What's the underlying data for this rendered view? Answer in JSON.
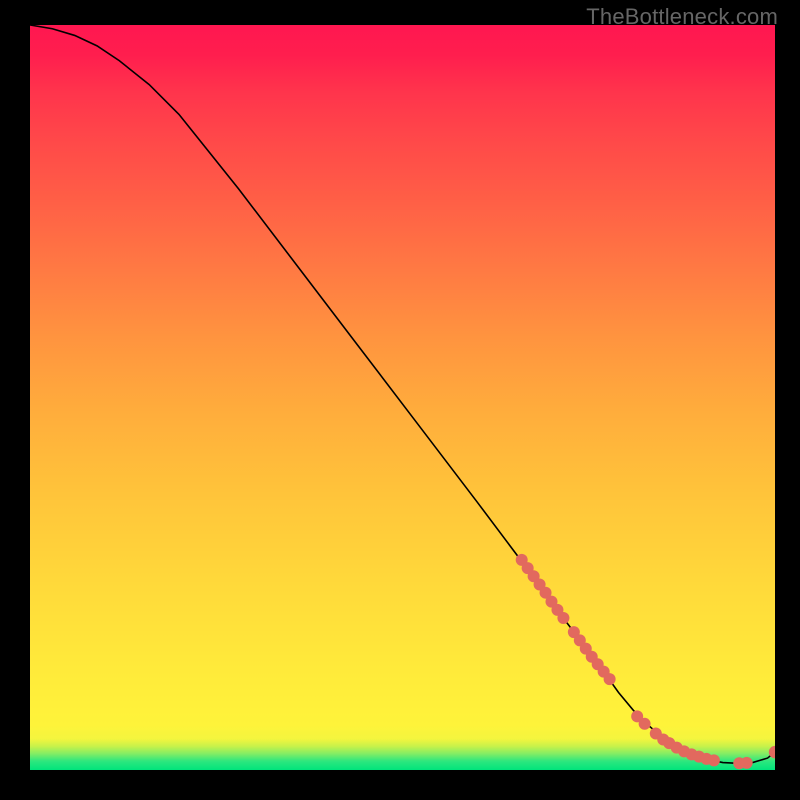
{
  "watermark": "TheBottleneck.com",
  "chart_data": {
    "type": "line",
    "title": "",
    "xlabel": "",
    "ylabel": "",
    "xlim": [
      0,
      100
    ],
    "ylim": [
      0,
      100
    ],
    "grid": false,
    "axes_visible": false,
    "series": [
      {
        "name": "bottleneck-curve",
        "x": [
          0,
          3,
          6,
          9,
          12,
          16,
          20,
          28,
          36,
          44,
          52,
          60,
          66,
          70,
          74,
          77,
          79,
          81,
          83,
          85,
          87,
          89,
          91,
          93,
          95,
          97,
          99,
          100
        ],
        "y": [
          100,
          99.5,
          98.6,
          97.2,
          95.2,
          92,
          88,
          78,
          67.5,
          57,
          46.5,
          36,
          28,
          22.5,
          17.2,
          13.2,
          10.4,
          8.0,
          6.0,
          4.3,
          3.0,
          2.0,
          1.4,
          1.0,
          0.9,
          1.0,
          1.6,
          2.4
        ]
      }
    ],
    "dot_groups": [
      {
        "name": "upper-cluster",
        "points": [
          [
            66.0,
            28.2
          ],
          [
            66.8,
            27.1
          ],
          [
            67.6,
            26.0
          ],
          [
            68.4,
            24.9
          ],
          [
            69.2,
            23.8
          ],
          [
            70.0,
            22.6
          ],
          [
            70.8,
            21.5
          ],
          [
            71.6,
            20.4
          ],
          [
            73.0,
            18.5
          ],
          [
            73.8,
            17.4
          ],
          [
            74.6,
            16.3
          ],
          [
            75.4,
            15.2
          ],
          [
            76.2,
            14.2
          ],
          [
            77.0,
            13.2
          ],
          [
            77.8,
            12.2
          ]
        ]
      },
      {
        "name": "lower-cluster",
        "points": [
          [
            81.5,
            7.2
          ],
          [
            82.5,
            6.2
          ],
          [
            84.0,
            4.9
          ],
          [
            85.0,
            4.1
          ],
          [
            85.8,
            3.6
          ],
          [
            86.8,
            3.0
          ],
          [
            87.8,
            2.5
          ],
          [
            88.8,
            2.1
          ],
          [
            89.8,
            1.8
          ],
          [
            90.8,
            1.5
          ],
          [
            91.8,
            1.3
          ]
        ]
      },
      {
        "name": "tail-pair",
        "points": [
          [
            95.2,
            0.9
          ],
          [
            96.2,
            0.95
          ]
        ]
      },
      {
        "name": "end-dot",
        "points": [
          [
            100,
            2.4
          ]
        ]
      }
    ],
    "colors": {
      "dot": "#e2695e",
      "line": "#000000"
    }
  }
}
